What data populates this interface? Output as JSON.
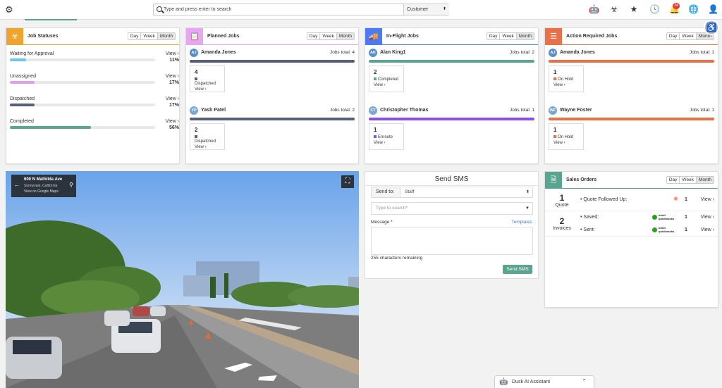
{
  "header": {
    "search_placeholder": "Type and press enter to search",
    "search_scope": "Customer",
    "notification_count": "34"
  },
  "colors": {
    "accent": "#5aa58f",
    "job_statuses": "#f0a430",
    "planned_jobs": "#e9a6f0",
    "in_flight_jobs": "#4b7bf0",
    "action_required_jobs": "#e8714a",
    "sales_orders": "#5aa58f"
  },
  "range_options": [
    "Day",
    "Week",
    "Month"
  ],
  "job_statuses": {
    "title": "Job Statuses",
    "rows": [
      {
        "label": "Waiting for Approval",
        "view": "View",
        "percent_label": "11%",
        "value": 11,
        "color": "#6ec6f0"
      },
      {
        "label": "Unassigned",
        "view": "View",
        "percent_label": "17%",
        "value": 17,
        "color": "#e49ef0"
      },
      {
        "label": "Dispatched",
        "view": "View",
        "percent_label": "17%",
        "value": 17,
        "color": "#56607a"
      },
      {
        "label": "Completed",
        "view": "View",
        "percent_label": "56%",
        "value": 56,
        "color": "#5aa58f"
      }
    ]
  },
  "planned_jobs": {
    "title": "Planned Jobs",
    "techs": [
      {
        "initials": "AJ",
        "name": "Amanda Jones",
        "total": "Jobs total: 4",
        "count": "4",
        "status": "Dispatched",
        "view": "View",
        "bar_color": "#56607a",
        "sq_color": "#56607a",
        "avatar_color": "#5b8ec9"
      },
      {
        "initials": "YP",
        "name": "Yash Patel",
        "total": "Jobs total: 2",
        "count": "2",
        "status": "Dispatched",
        "view": "View",
        "bar_color": "#56607a",
        "sq_color": "#56607a",
        "avatar_color": "#7aa6d6"
      }
    ]
  },
  "in_flight_jobs": {
    "title": "In-Flight Jobs",
    "techs": [
      {
        "initials": "AK",
        "name": "Alan King1",
        "total": "Jobs total: 2",
        "count": "2",
        "status": "Completed",
        "view": "View",
        "bar_color": "#5aa58f",
        "sq_color": "#5aa58f",
        "avatar_color": "#5b8ec9"
      },
      {
        "initials": "CT",
        "name": "Christopher Thomas",
        "total": "Jobs total: 1",
        "count": "1",
        "status": "Enroute",
        "view": "View",
        "bar_color": "#8a4df0",
        "sq_color": "#8a4df0",
        "avatar_color": "#7aa6d6"
      }
    ]
  },
  "action_required_jobs": {
    "title": "Action Required Jobs",
    "techs": [
      {
        "initials": "AJ",
        "name": "Amanda Jones",
        "total": "Jobs total: 1",
        "count": "1",
        "status": "On Hold",
        "view": "View",
        "bar_color": "#e8714a",
        "sq_color": "#e8714a",
        "avatar_color": "#5b8ec9"
      },
      {
        "initials": "WF",
        "name": "Wayne Foster",
        "total": "Jobs total: 1",
        "count": "1",
        "status": "On Hold",
        "view": "View",
        "bar_color": "#e8714a",
        "sq_color": "#e8714a",
        "avatar_color": "#7aa6d6"
      }
    ]
  },
  "street_view": {
    "address": "600 N Mathilda Ave",
    "city": "Sunnyvale, California",
    "link": "View on Google Maps"
  },
  "send_sms": {
    "title": "Send SMS",
    "send_to_label": "Send to:",
    "send_to_value": "Staff",
    "search_placeholder": "Type to search*",
    "message_label": "Message *",
    "templates_link": "Templates",
    "remaining": "255 characters remaining",
    "send_button": "Send SMS"
  },
  "sales_orders": {
    "title": "Sales Orders",
    "quote_count": "1",
    "quote_label": "Quote",
    "invoice_count": "2",
    "invoice_label": "Invoices",
    "items": [
      {
        "label": "• Quote Followed Up:",
        "count": "1",
        "view": "View"
      },
      {
        "label": "• Saved:",
        "count": "1",
        "view": "View"
      },
      {
        "label": "• Sent:",
        "count": "1",
        "view": "View"
      }
    ],
    "qb_top": "intuit",
    "qb_bottom": "quickbooks"
  },
  "assistant": {
    "title": "Dusk AI Assistant"
  }
}
